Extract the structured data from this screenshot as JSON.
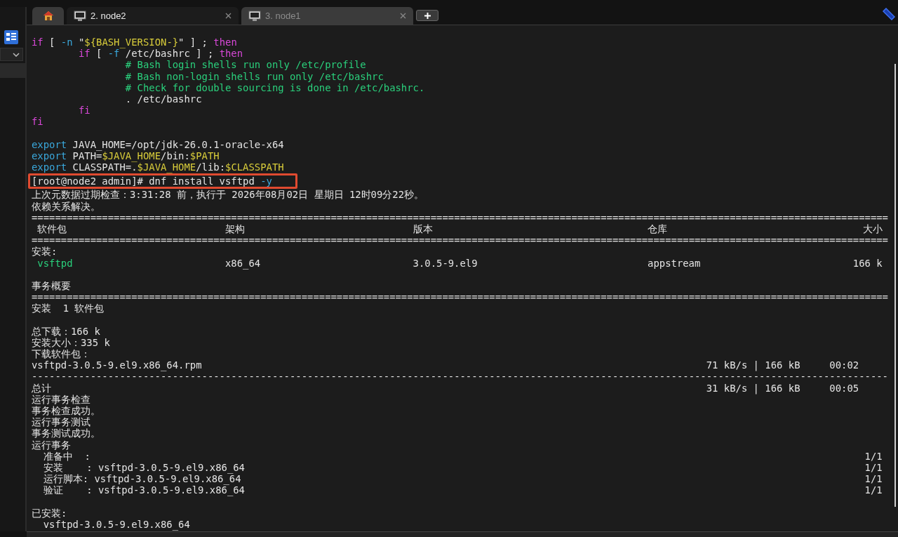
{
  "tabs": [
    {
      "kind": "home",
      "selected": false
    },
    {
      "kind": "terminal",
      "label": "2. node2",
      "selected": true
    },
    {
      "kind": "terminal",
      "label": "3. node1",
      "selected": false
    }
  ],
  "terminal": {
    "lines": [
      {
        "kind": "code",
        "segments": [
          {
            "text": "if",
            "kind": "keyword"
          },
          {
            "text": " [ ",
            "kind": "plain"
          },
          {
            "text": "-n",
            "kind": "option"
          },
          {
            "text": " \"",
            "kind": "plain"
          },
          {
            "text": "${BASH_VERSION-}",
            "kind": "string"
          },
          {
            "text": "\" ] ; ",
            "kind": "plain"
          },
          {
            "text": "then",
            "kind": "keyword"
          }
        ]
      },
      {
        "kind": "code",
        "segments": [
          {
            "text": "        if",
            "kind": "keyword"
          },
          {
            "text": " [ ",
            "kind": "plain"
          },
          {
            "text": "-f",
            "kind": "option"
          },
          {
            "text": " /etc/bashrc ] ; ",
            "kind": "plain"
          },
          {
            "text": "then",
            "kind": "keyword"
          }
        ]
      },
      {
        "kind": "code",
        "segments": [
          {
            "text": "                # Bash login shells run only /etc/profile",
            "kind": "comment"
          }
        ]
      },
      {
        "kind": "code",
        "segments": [
          {
            "text": "                # Bash non-login shells run only /etc/bashrc",
            "kind": "comment"
          }
        ]
      },
      {
        "kind": "code",
        "segments": [
          {
            "text": "                # Check for double sourcing is done in /etc/bashrc.",
            "kind": "comment"
          }
        ]
      },
      {
        "kind": "code",
        "segments": [
          {
            "text": "                . /etc/bashrc",
            "kind": "plain"
          }
        ]
      },
      {
        "kind": "code",
        "segments": [
          {
            "text": "        fi",
            "kind": "keyword"
          }
        ]
      },
      {
        "kind": "code",
        "segments": [
          {
            "text": "fi",
            "kind": "keyword"
          }
        ]
      },
      {
        "kind": "blank"
      },
      {
        "kind": "code",
        "segments": [
          {
            "text": "export",
            "kind": "option"
          },
          {
            "text": " JAVA_HOME=/opt/jdk-26.0.1-oracle-x64",
            "kind": "plain"
          }
        ]
      },
      {
        "kind": "code",
        "segments": [
          {
            "text": "export",
            "kind": "option"
          },
          {
            "text": " PATH=",
            "kind": "plain"
          },
          {
            "text": "$JAVA_HOME",
            "kind": "string"
          },
          {
            "text": "/bin:",
            "kind": "plain"
          },
          {
            "text": "$PATH",
            "kind": "string"
          }
        ]
      },
      {
        "kind": "code",
        "segments": [
          {
            "text": "export",
            "kind": "option"
          },
          {
            "text": " CLASSPATH=.",
            "kind": "plain"
          },
          {
            "text": "$JAVA_HOME",
            "kind": "string"
          },
          {
            "text": "/lib:",
            "kind": "plain"
          },
          {
            "text": "$CLASSPATH",
            "kind": "string"
          }
        ]
      },
      {
        "kind": "code",
        "highlighted": true,
        "segments": [
          {
            "text": "[root@node2 admin]# dnf install vsftpd ",
            "kind": "plain"
          },
          {
            "text": "-y",
            "kind": "option"
          }
        ]
      },
      {
        "kind": "code",
        "segments": [
          {
            "text": "上次元数据过期检查：3:31:28 前，执行于 2026年08月02日 星期日 12时09分22秒。",
            "kind": "plain"
          }
        ]
      },
      {
        "kind": "code",
        "segments": [
          {
            "text": "依赖关系解决。",
            "kind": "plain"
          }
        ]
      },
      {
        "kind": "rule",
        "text": "=================================================================================================================================================="
      },
      {
        "kind": "table",
        "cells": [
          "软件包",
          "架构",
          "版本",
          "仓库",
          "大小"
        ]
      },
      {
        "kind": "rule",
        "text": "=================================================================================================================================================="
      },
      {
        "kind": "code",
        "segments": [
          {
            "text": "安装:",
            "kind": "plain"
          }
        ]
      },
      {
        "kind": "table",
        "cells": [
          "vsftpd",
          "x86_64",
          "3.0.5-9.el9",
          "appstream",
          "166 k"
        ]
      },
      {
        "kind": "blank"
      },
      {
        "kind": "code",
        "segments": [
          {
            "text": "事务概要",
            "kind": "plain"
          }
        ]
      },
      {
        "kind": "rule",
        "text": "=================================================================================================================================================="
      },
      {
        "kind": "code",
        "segments": [
          {
            "text": "安装  1 软件包",
            "kind": "plain"
          }
        ]
      },
      {
        "kind": "blank"
      },
      {
        "kind": "code",
        "segments": [
          {
            "text": "总下载：166 k",
            "kind": "plain"
          }
        ]
      },
      {
        "kind": "code",
        "segments": [
          {
            "text": "安装大小：335 k",
            "kind": "plain"
          }
        ]
      },
      {
        "kind": "code",
        "segments": [
          {
            "text": "下载软件包：",
            "kind": "plain"
          }
        ]
      },
      {
        "kind": "transfer",
        "text": "vsftpd-3.0.5-9.el9.x86_64.rpm",
        "stats": "71 kB/s | 166 kB     00:02"
      },
      {
        "kind": "rule",
        "text": "--------------------------------------------------------------------------------------------------------------------------------------------------"
      },
      {
        "kind": "transfer",
        "text": "总计",
        "stats": "31 kB/s | 166 kB     00:05"
      },
      {
        "kind": "code",
        "segments": [
          {
            "text": "运行事务检查",
            "kind": "plain"
          }
        ]
      },
      {
        "kind": "code",
        "segments": [
          {
            "text": "事务检查成功。",
            "kind": "plain"
          }
        ]
      },
      {
        "kind": "code",
        "segments": [
          {
            "text": "运行事务测试",
            "kind": "plain"
          }
        ]
      },
      {
        "kind": "code",
        "segments": [
          {
            "text": "事务测试成功。",
            "kind": "plain"
          }
        ]
      },
      {
        "kind": "code",
        "segments": [
          {
            "text": "运行事务",
            "kind": "plain"
          }
        ]
      },
      {
        "kind": "step",
        "text": "  准备中  :",
        "count": "1/1"
      },
      {
        "kind": "step",
        "text": "  安装    : vsftpd-3.0.5-9.el9.x86_64",
        "count": "1/1"
      },
      {
        "kind": "step",
        "text": "  运行脚本: vsftpd-3.0.5-9.el9.x86_64",
        "count": "1/1"
      },
      {
        "kind": "step",
        "text": "  验证    : vsftpd-3.0.5-9.el9.x86_64",
        "count": "1/1"
      },
      {
        "kind": "blank"
      },
      {
        "kind": "code",
        "segments": [
          {
            "text": "已安装:",
            "kind": "plain"
          }
        ]
      },
      {
        "kind": "code",
        "segments": [
          {
            "text": "  vsftpd-3.0.5-9.el9.x86_64",
            "kind": "plain"
          }
        ]
      }
    ]
  }
}
